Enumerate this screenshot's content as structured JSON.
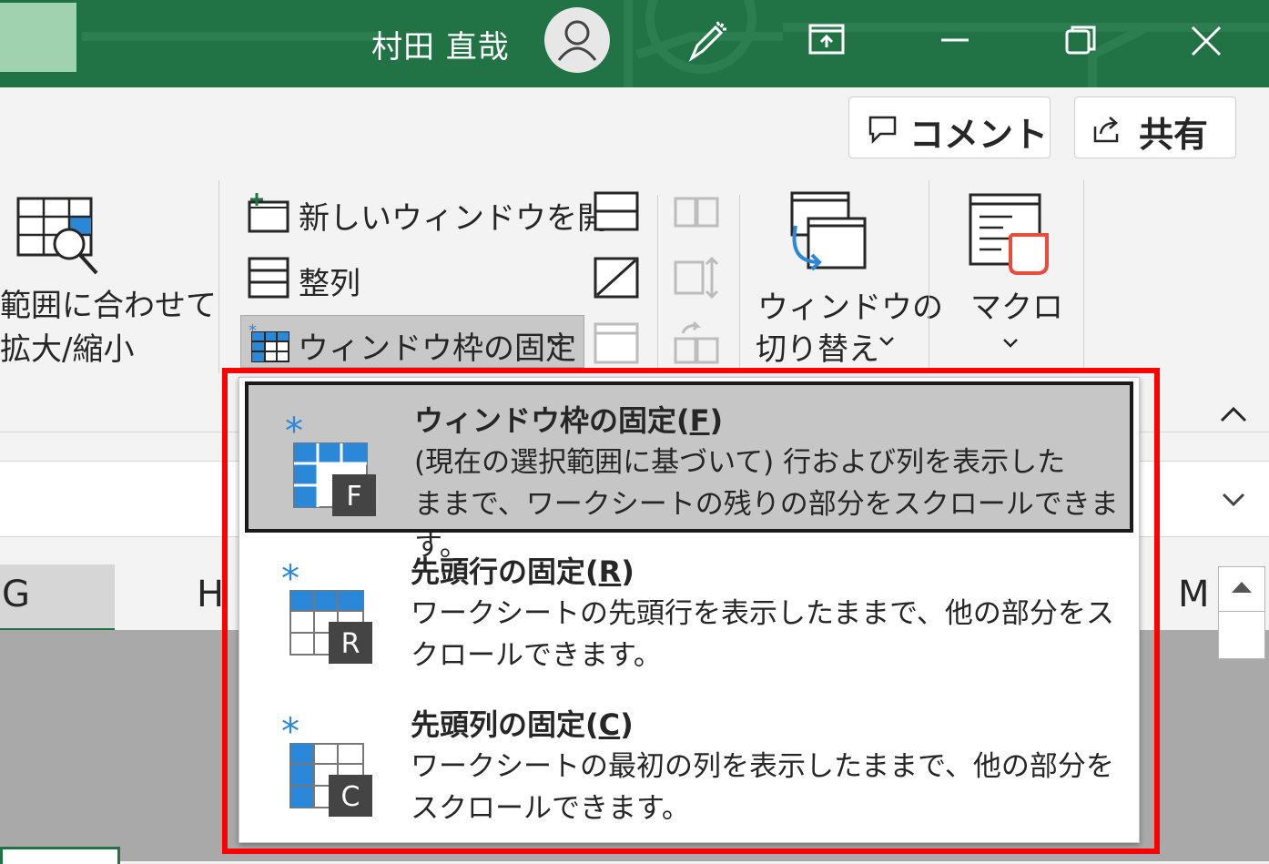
{
  "titlebar": {
    "user_name": "村田 直哉",
    "icons": [
      "avatar-icon",
      "pen-icon",
      "ribbon-display-icon",
      "minimize-icon",
      "restore-icon",
      "close-icon"
    ]
  },
  "top_buttons": {
    "comment_label": "コメント",
    "share_label": "共有"
  },
  "ribbon": {
    "zoom_selection_line1": "範囲に合わせて",
    "zoom_selection_line2": "拡大/縮小",
    "new_window": "新しいウィンドウを開く",
    "arrange": "整列",
    "freeze_panes": "ウィンドウ枠の固定",
    "switch_windows_line1": "ウィンドウの",
    "switch_windows_line2": "切り替え",
    "macros": "マクロ"
  },
  "columns": {
    "g": "G",
    "h": "H",
    "m": "M"
  },
  "dropdown": {
    "items": [
      {
        "title": "ウィンドウ枠の固定",
        "key": "F",
        "desc1": "(現在の選択範囲に基づいて) 行および列を表示した",
        "desc2": "ままで、ワークシートの残りの部分をスクロールできます。",
        "badge": "F"
      },
      {
        "title": "先頭行の固定",
        "key": "R",
        "desc1": "ワークシートの先頭行を表示したままで、他の部分をス",
        "desc2": "クロールできます。",
        "badge": "R"
      },
      {
        "title": "先頭列の固定",
        "key": "C",
        "desc1": "ワークシートの最初の列を表示したままで、他の部分を",
        "desc2": "スクロールできます。",
        "badge": "C"
      }
    ]
  },
  "colors": {
    "title_green": "#217346",
    "highlight_red": "#ff0000",
    "icon_blue": "#2b88d8"
  }
}
